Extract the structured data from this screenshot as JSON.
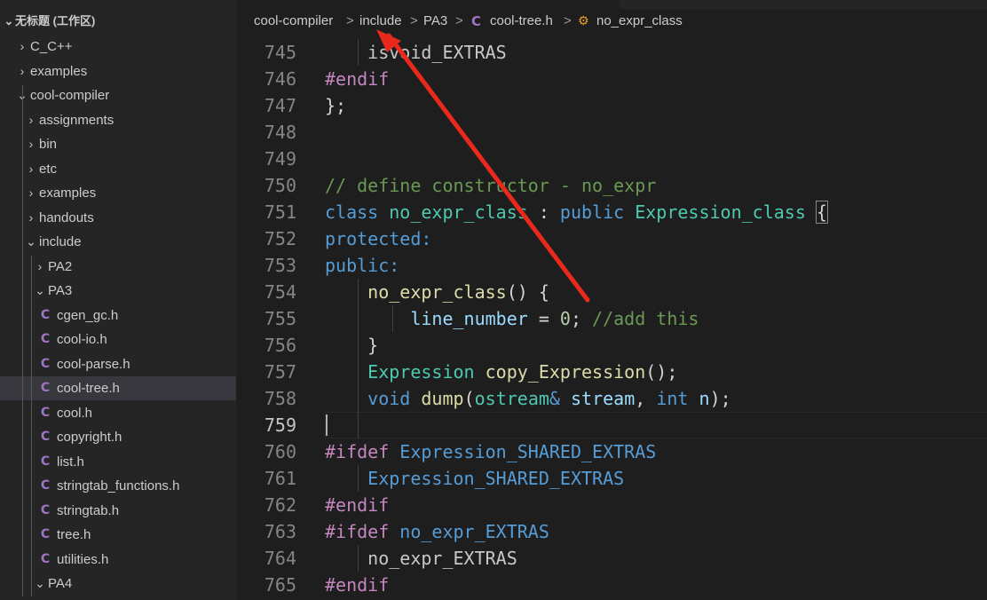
{
  "sidebar": {
    "workspace_title": "无标题 (工作区)",
    "items": [
      {
        "label": "C_C++",
        "kind": "folder",
        "state": "collapsed"
      },
      {
        "label": "examples",
        "kind": "folder",
        "state": "collapsed"
      },
      {
        "label": "cool-compiler",
        "kind": "folder",
        "state": "expanded"
      },
      {
        "label": "assignments",
        "kind": "folder",
        "state": "collapsed"
      },
      {
        "label": "bin",
        "kind": "folder",
        "state": "collapsed"
      },
      {
        "label": "etc",
        "kind": "folder",
        "state": "collapsed"
      },
      {
        "label": "examples",
        "kind": "folder",
        "state": "collapsed"
      },
      {
        "label": "handouts",
        "kind": "folder",
        "state": "collapsed"
      },
      {
        "label": "include",
        "kind": "folder",
        "state": "expanded"
      },
      {
        "label": "PA2",
        "kind": "folder",
        "state": "collapsed"
      },
      {
        "label": "PA3",
        "kind": "folder",
        "state": "expanded"
      },
      {
        "label": "cgen_gc.h",
        "kind": "file",
        "icon": "C"
      },
      {
        "label": "cool-io.h",
        "kind": "file",
        "icon": "C"
      },
      {
        "label": "cool-parse.h",
        "kind": "file",
        "icon": "C"
      },
      {
        "label": "cool-tree.h",
        "kind": "file",
        "icon": "C",
        "selected": true
      },
      {
        "label": "cool.h",
        "kind": "file",
        "icon": "C"
      },
      {
        "label": "copyright.h",
        "kind": "file",
        "icon": "C"
      },
      {
        "label": "list.h",
        "kind": "file",
        "icon": "C"
      },
      {
        "label": "stringtab_functions.h",
        "kind": "file",
        "icon": "C"
      },
      {
        "label": "stringtab.h",
        "kind": "file",
        "icon": "C"
      },
      {
        "label": "tree.h",
        "kind": "file",
        "icon": "C"
      },
      {
        "label": "utilities.h",
        "kind": "file",
        "icon": "C"
      },
      {
        "label": "PA4",
        "kind": "folder",
        "state": "expanded"
      }
    ]
  },
  "breadcrumb": {
    "items": [
      "cool-compiler",
      "include",
      "PA3",
      "cool-tree.h",
      "no_expr_class"
    ],
    "file_icon": "C",
    "separator": ">"
  },
  "editor": {
    "current_line": "759",
    "lines": [
      {
        "n": "745",
        "tokens": [
          {
            "t": "    isvoid_EXTRAS",
            "c": "t-dim"
          }
        ]
      },
      {
        "n": "746",
        "tokens": [
          {
            "t": "#endif",
            "c": "t-preproc"
          }
        ]
      },
      {
        "n": "747",
        "tokens": [
          {
            "t": "};",
            "c": "t-plain"
          }
        ]
      },
      {
        "n": "748",
        "tokens": []
      },
      {
        "n": "749",
        "tokens": []
      },
      {
        "n": "750",
        "tokens": [
          {
            "t": "// define constructor - no_expr",
            "c": "t-comment"
          }
        ]
      },
      {
        "n": "751",
        "tokens": [
          {
            "t": "class ",
            "c": "t-kw"
          },
          {
            "t": "no_expr_class",
            "c": "t-type"
          },
          {
            "t": " : ",
            "c": "t-plain"
          },
          {
            "t": "public ",
            "c": "t-kw"
          },
          {
            "t": "Expression_class",
            "c": "t-type"
          },
          {
            "t": " ",
            "c": "t-plain"
          },
          {
            "t": "{",
            "c": "t-plain brace-box"
          }
        ]
      },
      {
        "n": "752",
        "tokens": [
          {
            "t": "protected:",
            "c": "t-kw"
          }
        ]
      },
      {
        "n": "753",
        "tokens": [
          {
            "t": "public:",
            "c": "t-kw"
          }
        ]
      },
      {
        "n": "754",
        "tokens": [
          {
            "t": "    ",
            "c": "t-plain"
          },
          {
            "t": "no_expr_class",
            "c": "t-func"
          },
          {
            "t": "() {",
            "c": "t-plain"
          }
        ]
      },
      {
        "n": "755",
        "tokens": [
          {
            "t": "        ",
            "c": "t-plain"
          },
          {
            "t": "line_number",
            "c": "t-var"
          },
          {
            "t": " = ",
            "c": "t-plain"
          },
          {
            "t": "0",
            "c": "t-num"
          },
          {
            "t": "; ",
            "c": "t-plain"
          },
          {
            "t": "//add this",
            "c": "t-comment"
          }
        ]
      },
      {
        "n": "756",
        "tokens": [
          {
            "t": "    }",
            "c": "t-plain"
          }
        ]
      },
      {
        "n": "757",
        "tokens": [
          {
            "t": "    ",
            "c": "t-plain"
          },
          {
            "t": "Expression",
            "c": "t-type"
          },
          {
            "t": " ",
            "c": "t-plain"
          },
          {
            "t": "copy_Expression",
            "c": "t-func"
          },
          {
            "t": "();",
            "c": "t-plain"
          }
        ]
      },
      {
        "n": "758",
        "tokens": [
          {
            "t": "    ",
            "c": "t-plain"
          },
          {
            "t": "void",
            "c": "t-kw"
          },
          {
            "t": " ",
            "c": "t-plain"
          },
          {
            "t": "dump",
            "c": "t-func"
          },
          {
            "t": "(",
            "c": "t-plain"
          },
          {
            "t": "ostream",
            "c": "t-type"
          },
          {
            "t": "& ",
            "c": "t-kw"
          },
          {
            "t": "stream",
            "c": "t-var"
          },
          {
            "t": ", ",
            "c": "t-plain"
          },
          {
            "t": "int",
            "c": "t-kw"
          },
          {
            "t": " ",
            "c": "t-plain"
          },
          {
            "t": "n",
            "c": "t-var"
          },
          {
            "t": ");",
            "c": "t-plain"
          }
        ]
      },
      {
        "n": "759",
        "tokens": []
      },
      {
        "n": "760",
        "tokens": [
          {
            "t": "#ifdef ",
            "c": "t-preproc"
          },
          {
            "t": "Expression_SHARED_EXTRAS",
            "c": "t-macro"
          }
        ]
      },
      {
        "n": "761",
        "tokens": [
          {
            "t": "    ",
            "c": "t-plain"
          },
          {
            "t": "Expression_SHARED_EXTRAS",
            "c": "t-macro"
          }
        ]
      },
      {
        "n": "762",
        "tokens": [
          {
            "t": "#endif",
            "c": "t-preproc"
          }
        ]
      },
      {
        "n": "763",
        "tokens": [
          {
            "t": "#ifdef ",
            "c": "t-preproc"
          },
          {
            "t": "no_expr_EXTRAS",
            "c": "t-macro"
          }
        ]
      },
      {
        "n": "764",
        "tokens": [
          {
            "t": "    no_expr_EXTRAS",
            "c": "t-dim"
          }
        ]
      },
      {
        "n": "765",
        "tokens": [
          {
            "t": "#endif",
            "c": "t-preproc"
          }
        ]
      }
    ]
  },
  "colors": {
    "annotation_arrow": "#e8291c",
    "c_file_icon": "#a074c4",
    "symbol_icon": "#ee9d28"
  }
}
